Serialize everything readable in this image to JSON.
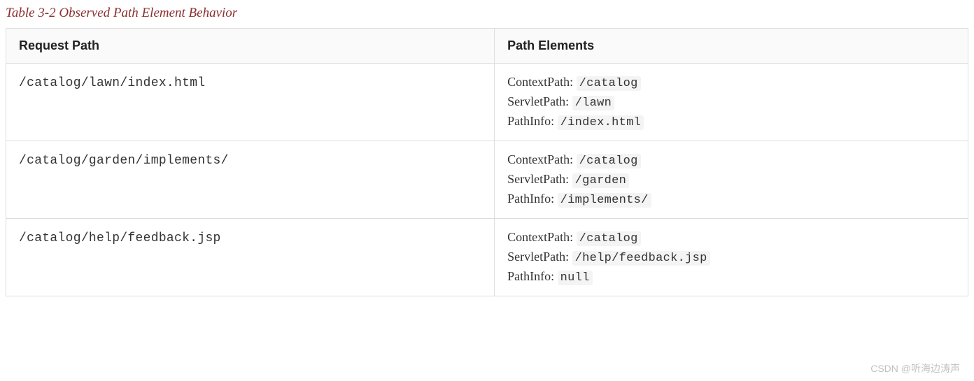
{
  "caption": "Table 3-2 Observed Path Element Behavior",
  "headers": {
    "col1": "Request Path",
    "col2": "Path Elements"
  },
  "labels": {
    "contextPath": "ContextPath: ",
    "servletPath": "ServletPath: ",
    "pathInfo": "PathInfo: "
  },
  "rows": [
    {
      "request": "/catalog/lawn/index.html",
      "contextPath": "/catalog",
      "servletPath": "/lawn",
      "pathInfo": "/index.html"
    },
    {
      "request": "/catalog/garden/implements/",
      "contextPath": "/catalog",
      "servletPath": "/garden",
      "pathInfo": "/implements/"
    },
    {
      "request": "/catalog/help/feedback.jsp",
      "contextPath": "/catalog",
      "servletPath": "/help/feedback.jsp",
      "pathInfo": "null"
    }
  ],
  "watermark": "CSDN @听海边涛声"
}
